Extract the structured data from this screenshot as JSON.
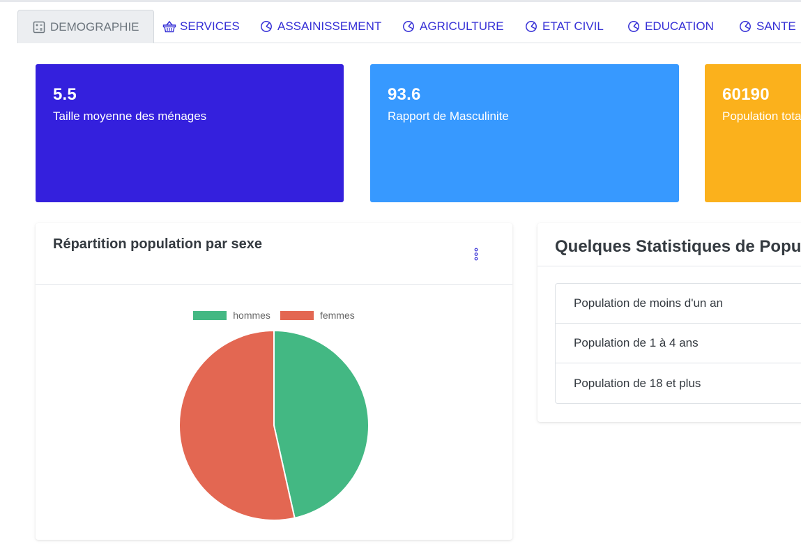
{
  "tabs": [
    {
      "label": "DEMOGRAPHIE",
      "icon": "calculator-icon",
      "active": true
    },
    {
      "label": "SERVICES",
      "icon": "basket-icon",
      "active": false
    },
    {
      "label": "ASSAINISSEMENT",
      "icon": "pie-chart-icon",
      "active": false
    },
    {
      "label": "AGRICULTURE",
      "icon": "pie-chart-icon",
      "active": false
    },
    {
      "label": "ETAT CIVIL",
      "icon": "pie-chart-icon",
      "active": false
    },
    {
      "label": "EDUCATION",
      "icon": "pie-chart-icon",
      "active": false
    },
    {
      "label": "SANTE",
      "icon": "pie-chart-icon",
      "active": false
    }
  ],
  "stats": [
    {
      "value": "5.5",
      "label": "Taille moyenne des ménages",
      "color": "#3420dd"
    },
    {
      "value": "93.6",
      "label": "Rapport de Masculinite",
      "color": "#3799ff"
    },
    {
      "value": "60190",
      "label": "Population totale",
      "color": "#fbb11c"
    }
  ],
  "pie_panel": {
    "title": "Répartition population par sexe",
    "menu_icon": "more-vertical-icon"
  },
  "stats_panel": {
    "title": "Quelques Statistiques de Population",
    "items": [
      "Population de moins d'un an",
      "Population de 1 à 4 ans",
      "Population de 18 et plus"
    ]
  },
  "chart_data": {
    "type": "pie",
    "categories": [
      "hommes",
      "femmes"
    ],
    "values": [
      46.5,
      53.5
    ],
    "colors": [
      "#43b883",
      "#e36752"
    ],
    "legend": "top"
  }
}
